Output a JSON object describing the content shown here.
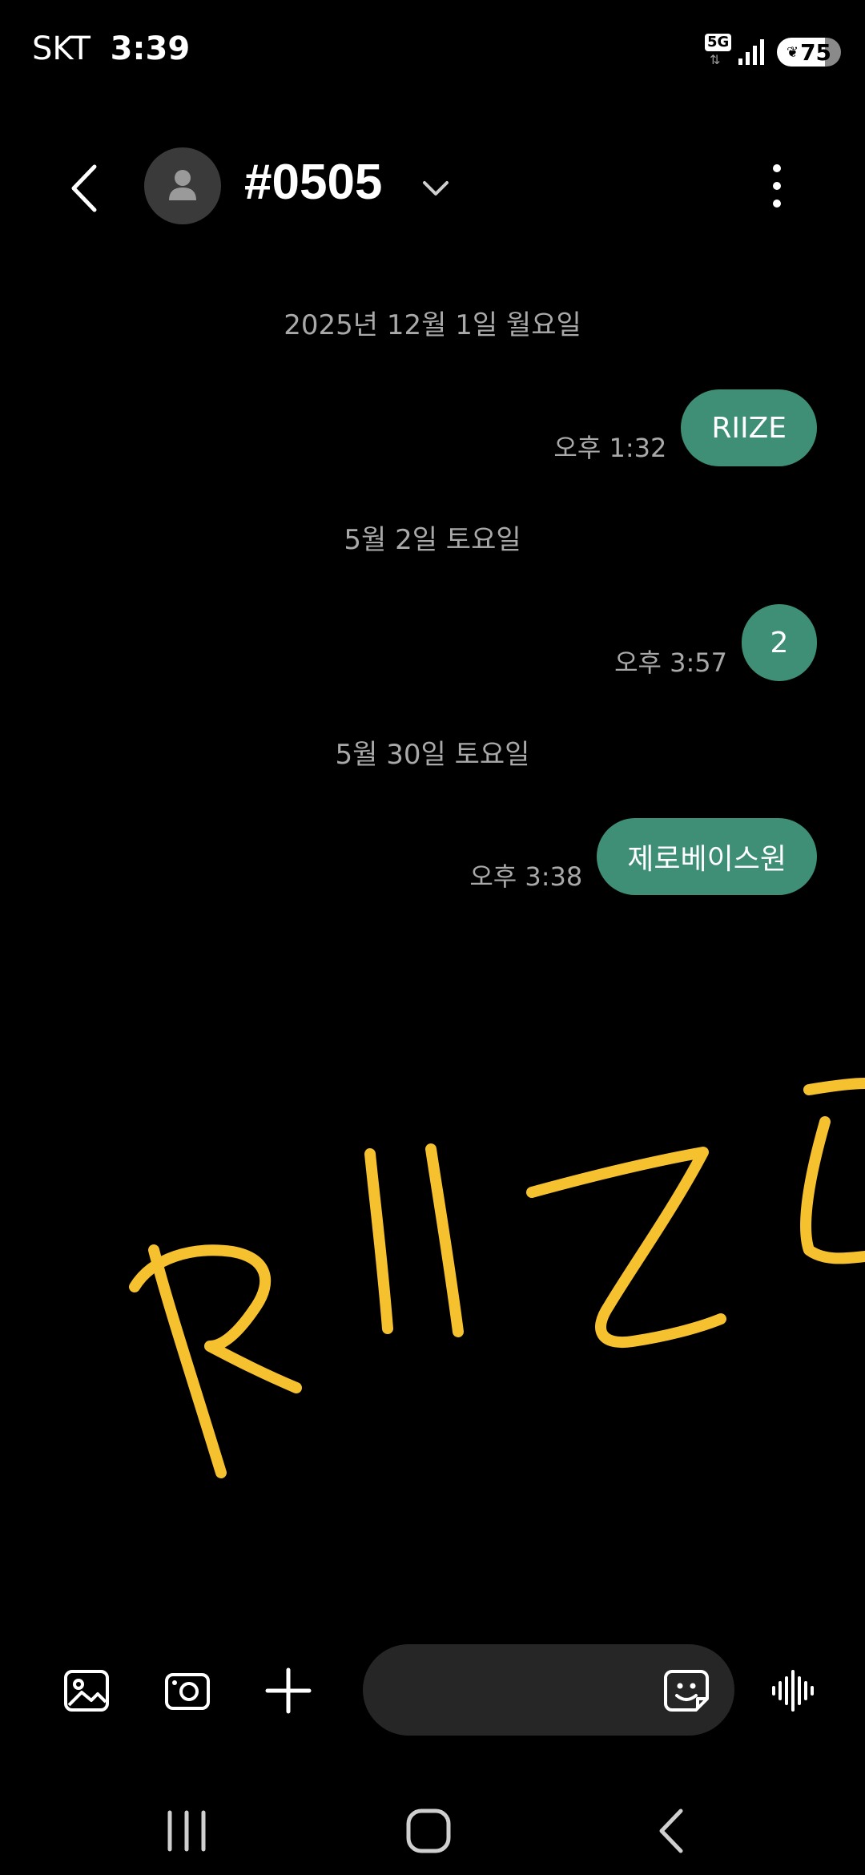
{
  "status_bar": {
    "carrier": "SKT",
    "time": "3:39",
    "network": "5G",
    "battery_level": "75"
  },
  "header": {
    "contact_name": "#0505",
    "icons": [
      "back-arrow-icon",
      "contact-avatar-icon",
      "chevron-down-icon",
      "more-vertical-icon"
    ]
  },
  "conversation": {
    "groups": [
      {
        "date": "2025년 12월 1일 월요일",
        "time": "오후 1:32",
        "message": "RIIZE"
      },
      {
        "date": "5월 2일 토요일",
        "time": "오후 3:57",
        "message": "2"
      },
      {
        "date": "5월 30일 토요일",
        "time": "오후 3:38",
        "message": "제로베이스원"
      }
    ],
    "bubble_color": "#3f8f77"
  },
  "drawing": {
    "stroke_color": "#f5c12e"
  },
  "composer": {
    "icons": [
      "gallery-icon",
      "camera-icon",
      "plus-icon",
      "sticker-icon",
      "voice-wave-icon"
    ]
  },
  "navigation_bar": {
    "icons": [
      "recent-apps-icon",
      "home-icon",
      "back-icon"
    ]
  }
}
